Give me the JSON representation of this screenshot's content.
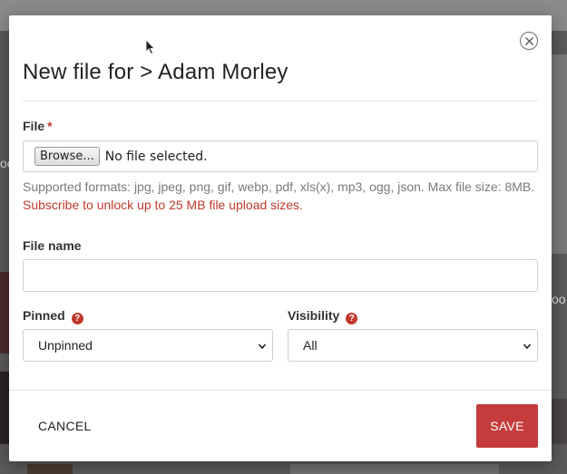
{
  "background": {
    "fragments": [
      "oo",
      "oo"
    ]
  },
  "modal": {
    "title": "New file for > Adam Morley",
    "close_icon": "close-circle-icon",
    "file_field": {
      "label": "File",
      "required_mark": "*",
      "browse_label": "Browse...",
      "status": "No file selected."
    },
    "help": {
      "formats_text": "Supported formats: jpg, jpeg, png, gif, webp, pdf, xls(x), mp3, ogg, json. Max file size: 8MB.",
      "upsell_text": "Subscribe to unlock up to 25 MB file upload sizes."
    },
    "file_name_field": {
      "label": "File name",
      "value": "",
      "placeholder": ""
    },
    "pinned_field": {
      "label": "Pinned",
      "help_icon": "?",
      "selected": "Unpinned"
    },
    "visibility_field": {
      "label": "Visibility",
      "help_icon": "?",
      "selected": "All"
    },
    "footer": {
      "cancel_label": "CANCEL",
      "save_label": "SAVE"
    }
  },
  "colors": {
    "accent": "#c43c3c",
    "required": "#c0392b",
    "help_text": "#7a7a7a"
  }
}
